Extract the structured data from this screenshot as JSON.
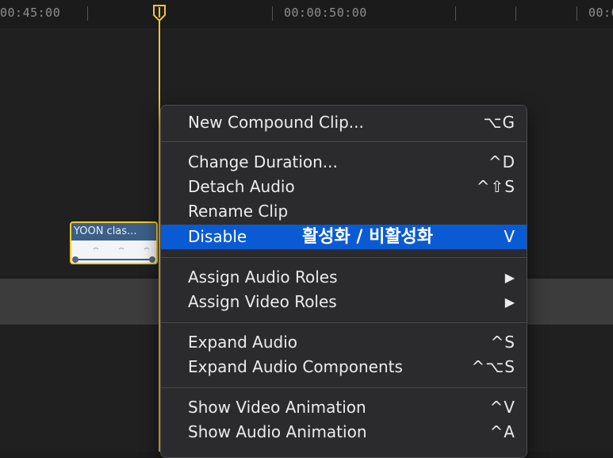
{
  "ruler": {
    "timecodes": [
      "00:45:00",
      "00:00:50:00",
      "00:0"
    ]
  },
  "clip": {
    "title": "YOON clas..."
  },
  "context_menu": {
    "groups": [
      [
        {
          "label": "New Compound Clip...",
          "shortcut": "⌥G"
        }
      ],
      [
        {
          "label": "Change Duration...",
          "shortcut": "^D"
        },
        {
          "label": "Detach Audio",
          "shortcut": "^⇧S"
        },
        {
          "label": "Rename Clip",
          "shortcut": ""
        },
        {
          "label": "Disable",
          "shortcut": "V",
          "highlighted": true,
          "annotation": "활성화 / 비활성화"
        }
      ],
      [
        {
          "label": "Assign Audio Roles",
          "shortcut": "▶"
        },
        {
          "label": "Assign Video Roles",
          "shortcut": "▶"
        }
      ],
      [
        {
          "label": "Expand Audio",
          "shortcut": "^S"
        },
        {
          "label": "Expand Audio Components",
          "shortcut": "^⌥S"
        }
      ],
      [
        {
          "label": "Show Video Animation",
          "shortcut": "^V"
        },
        {
          "label": "Show Audio Animation",
          "shortcut": "^A"
        }
      ]
    ]
  },
  "colors": {
    "playhead": "#f2c437",
    "highlight": "#0a5bd3",
    "clip_header": "#3b5f87"
  }
}
